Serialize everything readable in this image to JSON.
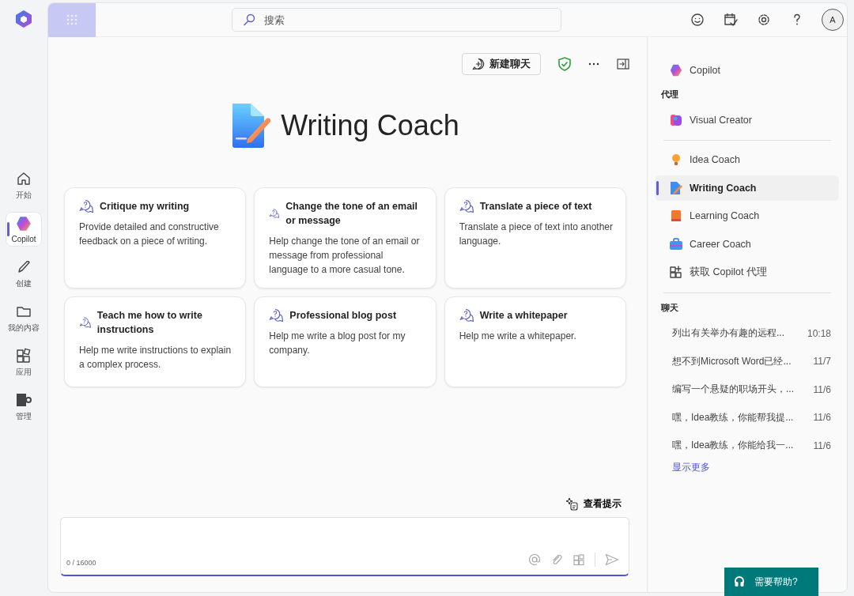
{
  "top_bar": {
    "search": {
      "placeholder": "搜索"
    },
    "avatar": "A"
  },
  "left_nav": [
    {
      "label": "开始",
      "selected": false
    },
    {
      "label": "Copilot",
      "selected": true
    },
    {
      "label": "创建",
      "selected": false
    },
    {
      "label": "我的内容",
      "selected": false
    },
    {
      "label": "应用",
      "selected": false
    },
    {
      "label": "管理",
      "selected": false
    }
  ],
  "toolbar": {
    "new_chat": "新建聊天"
  },
  "title": "Writing Coach",
  "prompts": [
    {
      "title": "Critique my writing",
      "description": "Provide detailed and constructive feedback on a piece of writing."
    },
    {
      "title": "Change the tone of an email or message",
      "description": "Help change the tone of an email or message from professional language to a more casual tone."
    },
    {
      "title": "Translate a piece of text",
      "description": "Translate a piece of text into another language."
    },
    {
      "title": "Teach me how to write instructions",
      "description": "Help me write instructions to explain a complex process."
    },
    {
      "title": "Professional blog post",
      "description": "Help me write a blog post for my company."
    },
    {
      "title": "Write a whitepaper",
      "description": "Help me write a whitepaper."
    }
  ],
  "view_prompts": "查看提示",
  "composer": {
    "counter": "0 / 16000"
  },
  "right_panel": {
    "copilot": "Copilot",
    "agents_heading": "代理",
    "pinned_agents": [
      {
        "label": "Visual Creator",
        "selected": false
      }
    ],
    "agents": [
      {
        "label": "Idea Coach",
        "selected": false
      },
      {
        "label": "Writing Coach",
        "selected": true
      },
      {
        "label": "Learning Coach",
        "selected": false
      },
      {
        "label": "Career Coach",
        "selected": false
      }
    ],
    "get_agents": "获取 Copilot 代理",
    "chats_heading": "聊天",
    "chats": [
      {
        "title": "列出有关举办有趣的远程...",
        "time": "10:18"
      },
      {
        "title": "想不到Microsoft Word已经...",
        "time": "11/7"
      },
      {
        "title": "编写一个悬疑的职场开头，...",
        "time": "11/6"
      },
      {
        "title": "嘿，Idea教练，你能帮我提...",
        "time": "11/6"
      },
      {
        "title": "嘿，Idea教练，你能给我一...",
        "time": "11/6"
      }
    ],
    "show_more": "显示更多"
  },
  "help_button": "需要帮助?"
}
